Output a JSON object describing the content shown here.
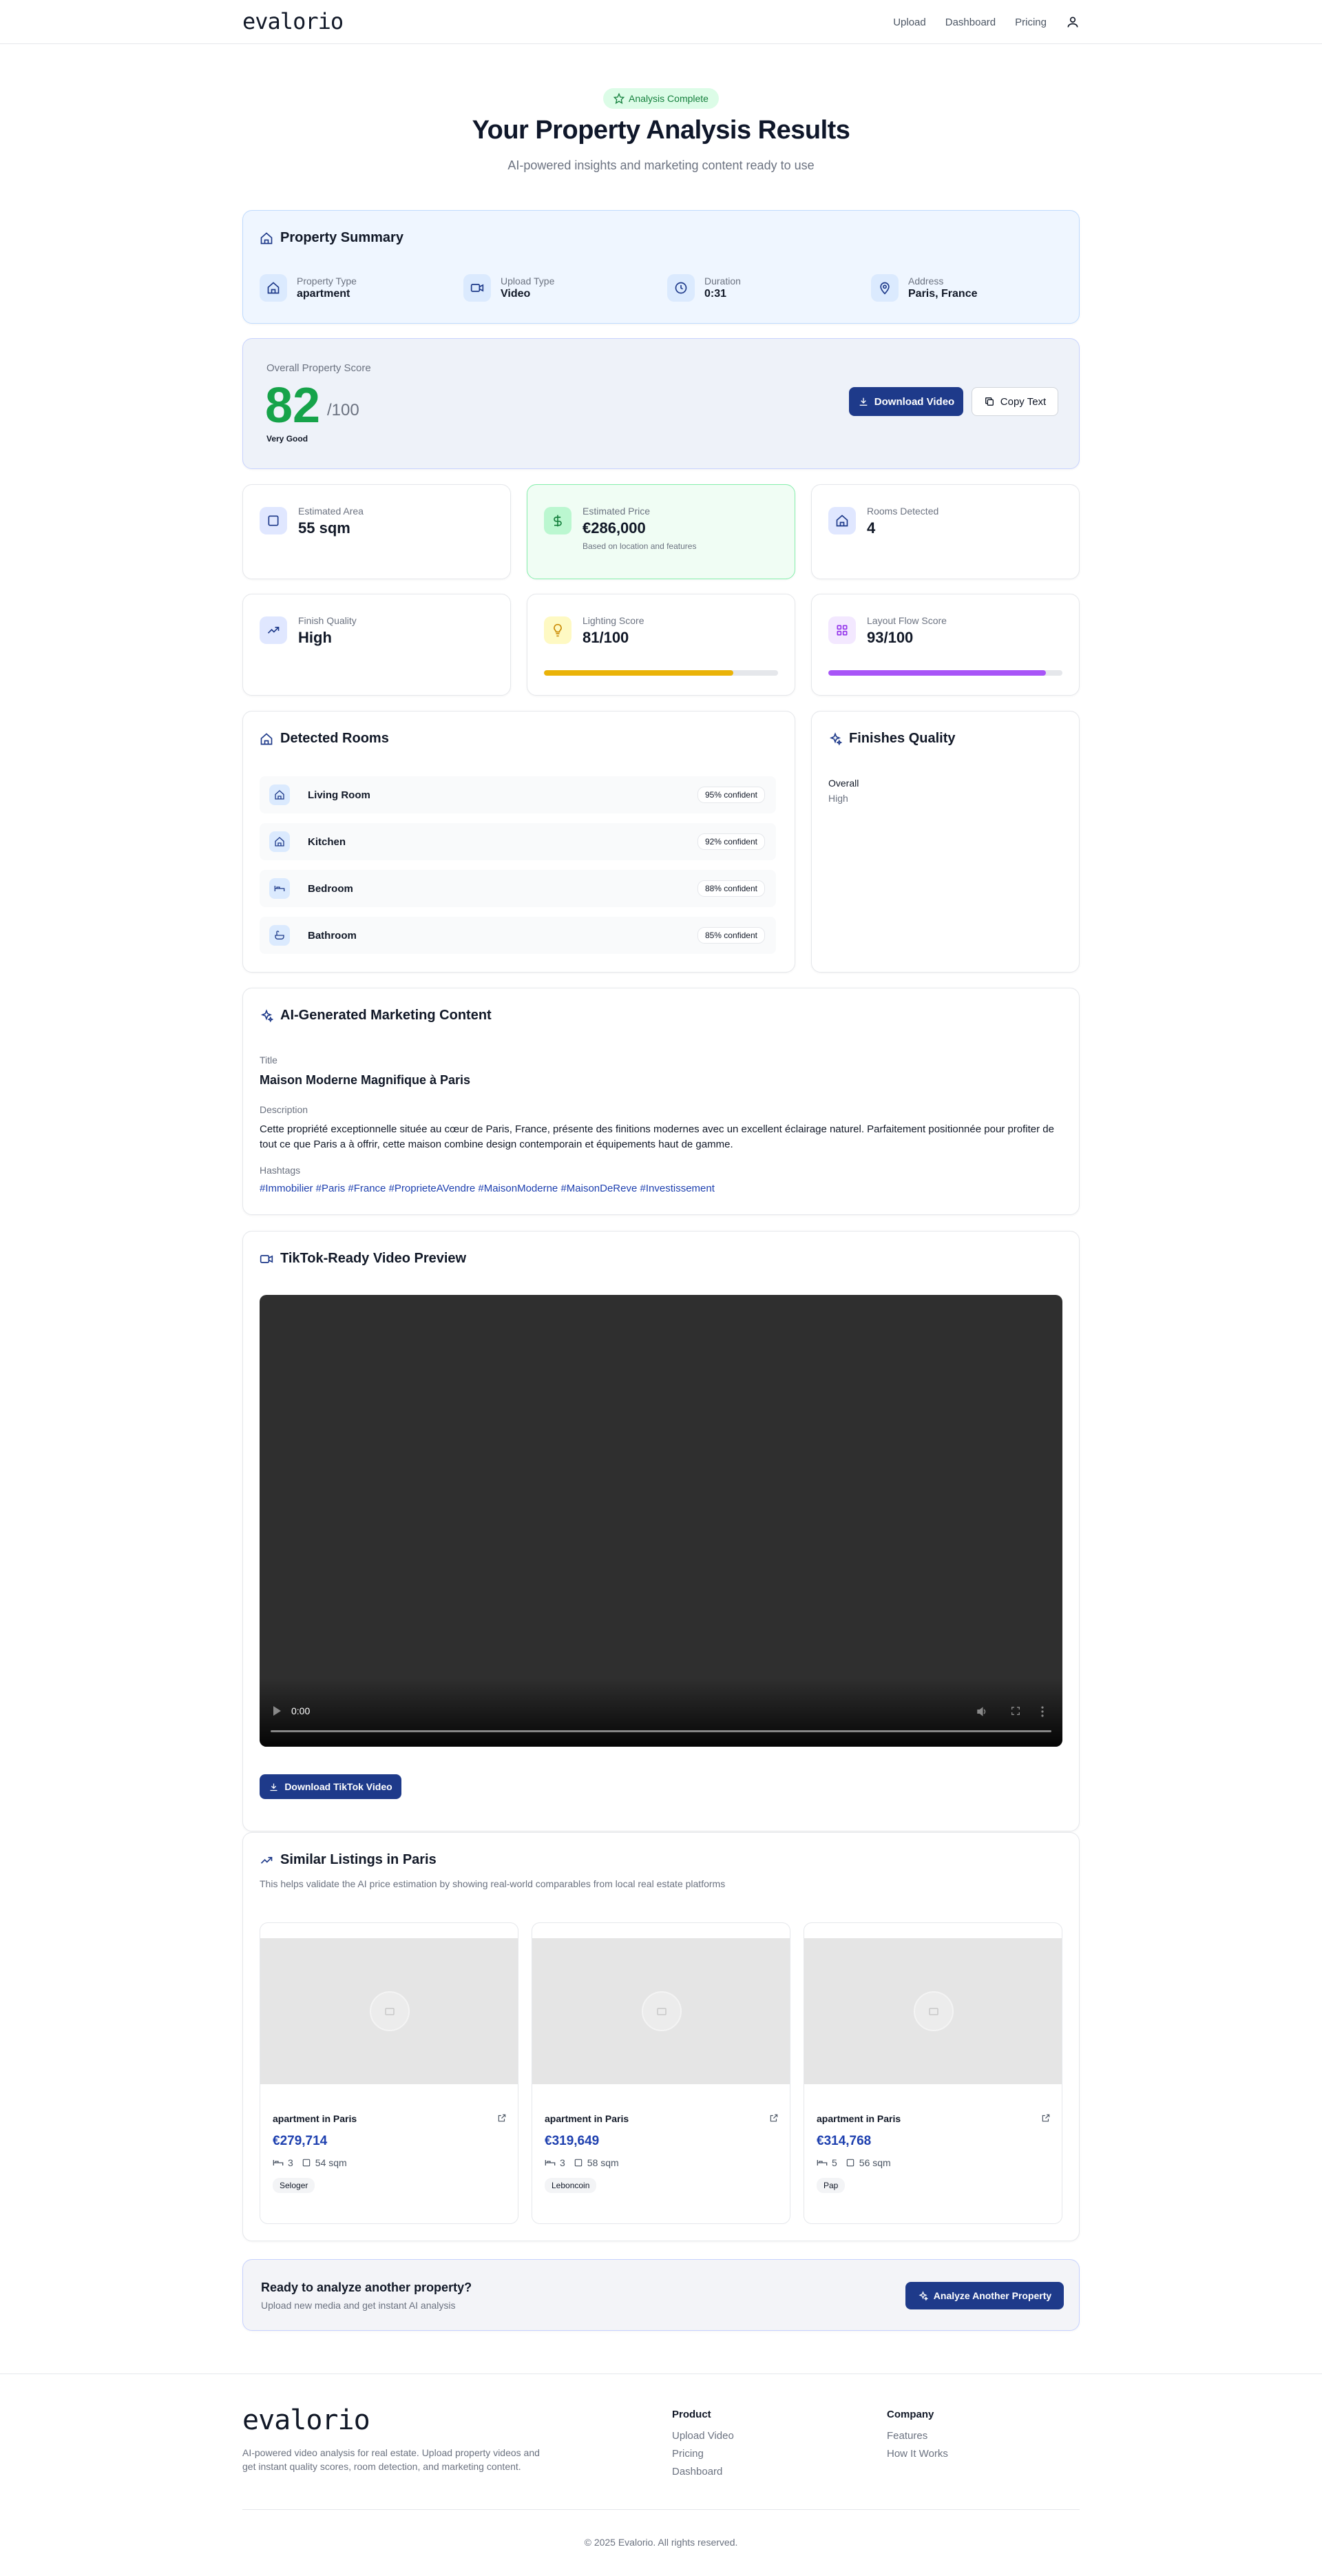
{
  "nav": {
    "logo": "evalorio",
    "links": [
      "Upload",
      "Dashboard",
      "Pricing"
    ]
  },
  "hero": {
    "badge": "Analysis Complete",
    "title": "Your Property Analysis Results",
    "subtitle": "AI-powered insights and marketing content ready to use"
  },
  "summary": {
    "title": "Property Summary",
    "items": [
      {
        "label": "Property Type",
        "value": "apartment",
        "icon": "home-icon"
      },
      {
        "label": "Upload Type",
        "value": "Video",
        "icon": "video-icon"
      },
      {
        "label": "Duration",
        "value": "0:31",
        "icon": "clock-icon"
      },
      {
        "label": "Address",
        "value": "Paris, France",
        "icon": "map-pin-icon"
      }
    ]
  },
  "score": {
    "label": "Overall Property Score",
    "value": "82",
    "max": "/100",
    "rating": "Very Good",
    "download_label": "Download Video",
    "copy_label": "Copy Text"
  },
  "stats": [
    {
      "label": "Estimated Area",
      "value": "55 sqm",
      "note": ""
    },
    {
      "label": "Estimated Price",
      "value": "€286,000",
      "note": "Based on location and features"
    },
    {
      "label": "Rooms Detected",
      "value": "4",
      "note": ""
    },
    {
      "label": "Finish Quality",
      "value": "High",
      "note": ""
    },
    {
      "label": "Lighting Score",
      "value": "81/100",
      "note": "",
      "fraction": 0.81
    },
    {
      "label": "Layout Flow Score",
      "value": "93/100",
      "note": "",
      "fraction": 0.93
    }
  ],
  "rooms": {
    "title": "Detected Rooms",
    "items": [
      {
        "name": "Living Room",
        "confidence": "95% confident"
      },
      {
        "name": "Kitchen",
        "confidence": "92% confident"
      },
      {
        "name": "Bedroom",
        "confidence": "88% confident"
      },
      {
        "name": "Bathroom",
        "confidence": "85% confident"
      }
    ]
  },
  "finishes": {
    "title": "Finishes Quality",
    "label": "Overall",
    "value": "High"
  },
  "marketing": {
    "title": "AI-Generated Marketing Content",
    "title_label": "Title",
    "title_value": "Maison Moderne Magnifique à Paris",
    "description_label": "Description",
    "description": "Cette propriété exceptionnelle située au cœur de Paris, France, présente des finitions modernes avec un excellent éclairage naturel. Parfaitement positionnée pour profiter de tout ce que Paris a à offrir, cette maison combine design contemporain et équipements haut de gamme.",
    "hashtags_label": "Hashtags",
    "hashtags": "#Immobilier #Paris #France #ProprieteAVendre #MaisonModerne #MaisonDeReve #Investissement"
  },
  "video": {
    "title": "TikTok-Ready Video Preview",
    "time": "0:00",
    "download_label": "Download TikTok Video"
  },
  "similar": {
    "title": "Similar Listings in Paris",
    "subtitle": "This helps validate the AI price estimation by showing real-world comparables from local real estate platforms",
    "listings": [
      {
        "title": "apartment in Paris",
        "price": "€279,714",
        "beds": "3",
        "area": "54 sqm",
        "source": "Seloger"
      },
      {
        "title": "apartment in Paris",
        "price": "€319,649",
        "beds": "3",
        "area": "58 sqm",
        "source": "Leboncoin"
      },
      {
        "title": "apartment in Paris",
        "price": "€314,768",
        "beds": "5",
        "area": "56 sqm",
        "source": "Pap"
      }
    ]
  },
  "cta": {
    "title": "Ready to analyze another property?",
    "subtitle": "Upload new media and get instant AI analysis",
    "button": "Analyze Another Property"
  },
  "footer": {
    "logo": "evalorio",
    "description": "AI-powered video analysis for real estate. Upload property videos and get instant quality scores, room detection, and marketing content.",
    "product_title": "Product",
    "product_links": [
      "Upload Video",
      "Pricing",
      "Dashboard"
    ],
    "company_title": "Company",
    "company_links": [
      "Features",
      "How It Works"
    ],
    "copyright": "© 2025 Evalorio. All rights reserved."
  },
  "colors": {
    "primary": "#1e3a8a",
    "score_green": "#16a34a",
    "lighting_bar": "#eab308",
    "layout_bar": "#a855f7"
  }
}
